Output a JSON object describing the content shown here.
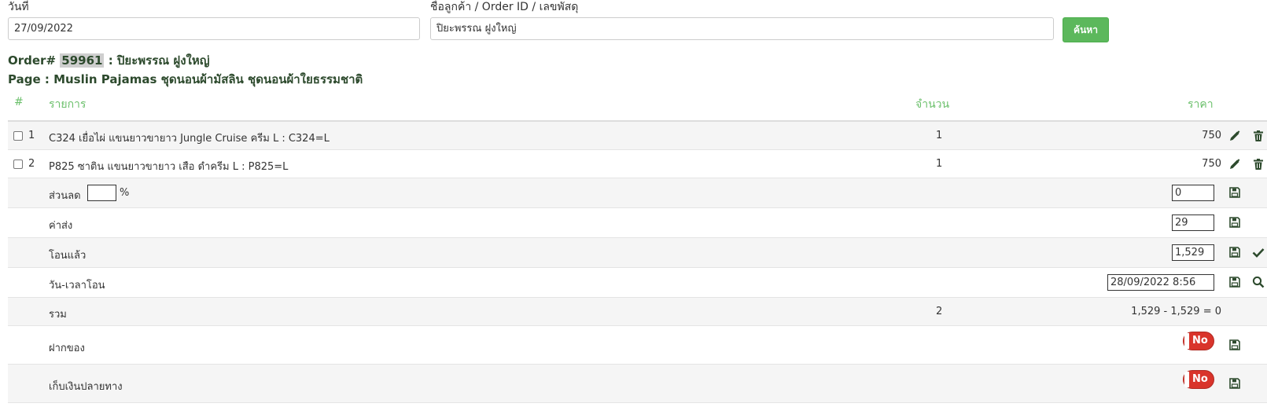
{
  "search": {
    "date_label": "วันที่",
    "date_value": "27/09/2022",
    "query_label": "ชื่อลูกค้า / Order ID / เลขพัสดุ",
    "query_value": "ปิยะพรรณ ฝูงใหญ่",
    "search_button": "ค้นหา"
  },
  "order": {
    "prefix": "Order#",
    "id": "59961",
    "customer": ": ปิยะพรรณ ฝูงใหญ่",
    "page_line": "Page : Muslin Pajamas ชุดนอนผ้ามัสลิน ชุดนอนผ้าใยธรรมชาติ"
  },
  "table": {
    "headers": {
      "index": "#",
      "item": "รายการ",
      "qty": "จำนวน",
      "price": "ราคา"
    },
    "items": [
      {
        "index": "1",
        "name": "C324 เยื่อไผ่ แขนยาวขายาว Jungle Cruise ครีม L : C324=L",
        "qty": "1",
        "price": "750"
      },
      {
        "index": "2",
        "name": "P825 ซาติน แขนยาวขายาว เสือ ดำครีม L : P825=L",
        "qty": "1",
        "price": "750"
      }
    ],
    "discount": {
      "label": "ส่วนลด",
      "percent_value": "",
      "percent_sign": "%",
      "value": "0"
    },
    "shipping": {
      "label": "ค่าส่ง",
      "value": "29"
    },
    "transferred": {
      "label": "โอนแล้ว",
      "value": "1,529"
    },
    "transfer_time": {
      "label": "วัน-เวลาโอน",
      "value": "28/09/2022 8:56"
    },
    "total": {
      "label": "รวม",
      "qty": "2",
      "summary": "1,529 - 1,529 = 0"
    },
    "deposit": {
      "label": "ฝากของ",
      "toggle": "No"
    },
    "cod": {
      "label": "เก็บเงินปลายทาง",
      "toggle": "No"
    }
  },
  "colors": {
    "accent_green": "#5cb85c",
    "header_green": "#6cc06c",
    "icon_dark": "#2d4a2d",
    "toggle_red": "#d9342b"
  }
}
